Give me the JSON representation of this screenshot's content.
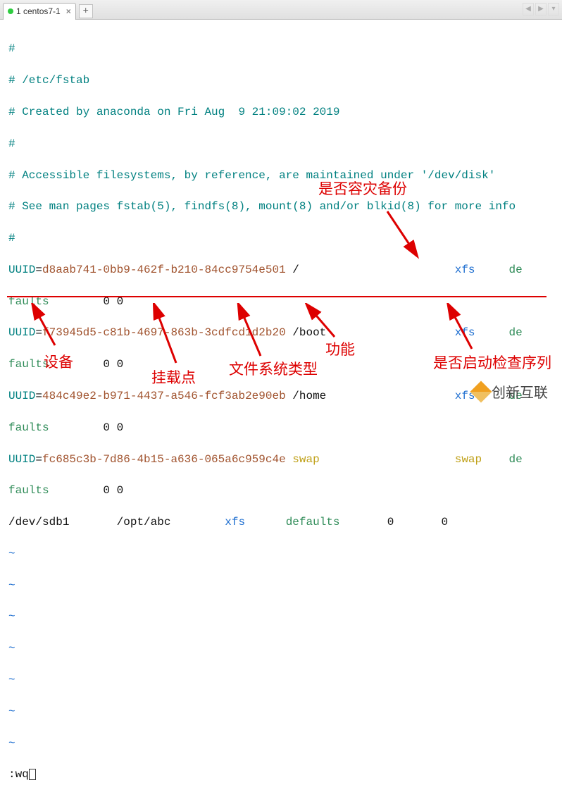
{
  "tab": {
    "label": "1 centos7-1"
  },
  "comments": {
    "l1": "#",
    "l2": "# /etc/fstab",
    "l3": "# Created by anaconda on Fri Aug  9 21:09:02 2019",
    "l4": "#",
    "l5": "# Accessible filesystems, by reference, are maintained under '/dev/disk'",
    "l6": "# See man pages fstab(5), findfs(8), mount(8) and/or blkid(8) for more info",
    "l7": "#"
  },
  "entries": [
    {
      "uuid_label": "UUID",
      "eq": "=",
      "uuid": "d8aab741-0bb9-462f-b210-84cc9754e501",
      "mount": " /",
      "fs": "xfs",
      "opts": "de",
      "nl_opts": "faults",
      "dump_pass": "0 0"
    },
    {
      "uuid_label": "UUID",
      "eq": "=",
      "uuid": "f73945d5-c81b-4697-863b-3cdfcd1d2b20",
      "mount": " /boot",
      "fs": "xfs",
      "opts": "de",
      "nl_opts": "faults",
      "dump_pass": "0 0"
    },
    {
      "uuid_label": "UUID",
      "eq": "=",
      "uuid": "484c49e2-b971-4437-a546-fcf3ab2e90eb",
      "mount": " /home",
      "fs": "xfs",
      "opts": "de",
      "nl_opts": "faults",
      "dump_pass": "0 0"
    },
    {
      "uuid_label": "UUID",
      "eq": "=",
      "uuid": "fc685c3b-7d86-4b15-a636-065a6c959c4e",
      "mount_swap": " swap",
      "fs": "swap",
      "opts": "de",
      "nl_opts": "faults",
      "dump_pass": "0 0"
    }
  ],
  "new_entry": {
    "dev": "/dev/sdb1",
    "gap1": "       ",
    "mount": "/opt/abc",
    "gap2": "        ",
    "fs": "xfs",
    "gap3": "      ",
    "opts": "defaults",
    "gap4": "       ",
    "dump": "0",
    "gap5": "       ",
    "pass": "0"
  },
  "tilde": "~",
  "cmd": ":wq",
  "annotations": {
    "backup": "是否容灾备份",
    "device": "设备",
    "mount": "挂载点",
    "fstype": "文件系统类型",
    "func": "功能",
    "check": "是否启动检查序列"
  },
  "watermark": "创新互联",
  "colors": {
    "comment": "#008080",
    "uuid_key": "#008080",
    "uuid_val": "#a0522d",
    "mount": "#111",
    "fs": "#1f6fd0",
    "opts": "#2e8b57",
    "swap": "#bfa017",
    "annotation": "#d00"
  }
}
